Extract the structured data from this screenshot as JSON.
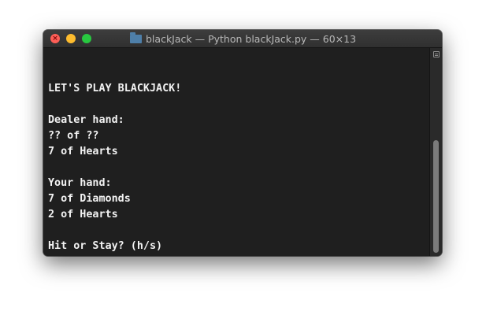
{
  "window": {
    "title": "blackJack — Python blackJack.py — 60×13"
  },
  "terminal": {
    "lines": [
      "",
      "LET'S PLAY BLACKJACK!",
      "",
      "Dealer hand:",
      "?? of ??",
      "7 of Hearts",
      "",
      "Your hand:",
      "7 of Diamonds",
      "2 of Hearts",
      "",
      "Hit or Stay? (h/s)"
    ],
    "prompt": ">",
    "input_value": ""
  },
  "colors": {
    "background": "#1f1f1f",
    "text": "#f2f2f2",
    "cursor": "#ff8c00",
    "close": "#fe5f57",
    "minimize": "#febc2e",
    "maximize": "#28c840"
  },
  "icons": {
    "folder": "folder-icon",
    "scroll_button": "scroll-button-icon"
  }
}
